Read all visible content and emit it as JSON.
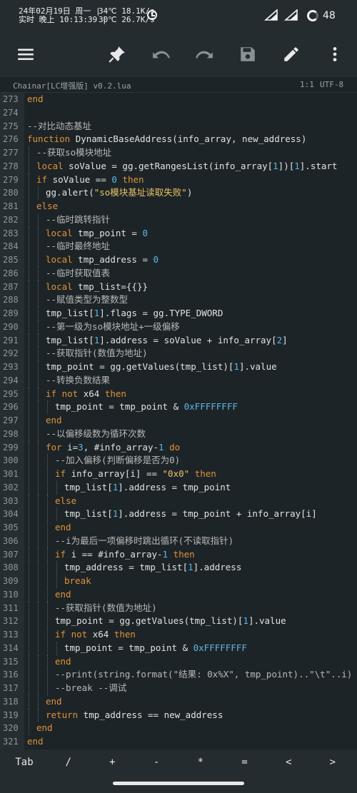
{
  "status": {
    "date_line": "24年02月19日 周一 |",
    "time_line": "实时 晚上 10:13:39 |",
    "temp_line1": "34℃  18.1K/s",
    "temp_line2": "30℃  26.7K/s",
    "battery": "48"
  },
  "toolbar": {
    "items": [
      "menu-icon",
      "pin-icon",
      "undo-icon",
      "redo-icon",
      "save-icon",
      "edit-icon",
      "more-icon"
    ]
  },
  "file": {
    "name": "Chainar[LC增强版] v0.2.lua",
    "position": "1:1",
    "encoding": "UTF-8"
  },
  "lines": [
    {
      "n": "273",
      "indent": 0,
      "tokens": [
        [
          "k",
          "end"
        ]
      ]
    },
    {
      "n": "274",
      "indent": 0,
      "tokens": []
    },
    {
      "n": "275",
      "indent": 0,
      "tokens": [
        [
          "c",
          "--对比动态基址"
        ]
      ]
    },
    {
      "n": "276",
      "indent": 0,
      "tokens": [
        [
          "k",
          "function"
        ],
        [
          "f",
          " DynamicBaseAddress(info_array, new_address)"
        ]
      ]
    },
    {
      "n": "277",
      "indent": 1,
      "tokens": [
        [
          "c",
          "--获取so模块地址"
        ]
      ]
    },
    {
      "n": "278",
      "indent": 1,
      "tokens": [
        [
          "k",
          "local"
        ],
        [
          "f",
          " soValue = gg.getRangesList(info_array["
        ],
        [
          "n",
          "1"
        ],
        [
          "f",
          "])["
        ],
        [
          "n",
          "1"
        ],
        [
          "f",
          "].start"
        ]
      ]
    },
    {
      "n": "279",
      "indent": 1,
      "tokens": [
        [
          "k",
          "if"
        ],
        [
          "f",
          " soValue == "
        ],
        [
          "n",
          "0"
        ],
        [
          "f",
          " "
        ],
        [
          "k",
          "then"
        ]
      ]
    },
    {
      "n": "280",
      "indent": 2,
      "tokens": [
        [
          "f",
          "gg.alert("
        ],
        [
          "s",
          "\"so模块基址读取失败\""
        ],
        [
          "f",
          ")"
        ]
      ]
    },
    {
      "n": "281",
      "indent": 1,
      "tokens": [
        [
          "k",
          "else"
        ]
      ]
    },
    {
      "n": "282",
      "indent": 2,
      "tokens": [
        [
          "c",
          "--临时跳转指针"
        ]
      ]
    },
    {
      "n": "283",
      "indent": 2,
      "tokens": [
        [
          "k",
          "local"
        ],
        [
          "f",
          " tmp_point = "
        ],
        [
          "n",
          "0"
        ]
      ]
    },
    {
      "n": "284",
      "indent": 2,
      "tokens": [
        [
          "c",
          "--临时最终地址"
        ]
      ]
    },
    {
      "n": "285",
      "indent": 2,
      "tokens": [
        [
          "k",
          "local"
        ],
        [
          "f",
          " tmp_address = "
        ],
        [
          "n",
          "0"
        ]
      ]
    },
    {
      "n": "286",
      "indent": 2,
      "tokens": [
        [
          "c",
          "--临时获取值表"
        ]
      ]
    },
    {
      "n": "287",
      "indent": 2,
      "tokens": [
        [
          "k",
          "local"
        ],
        [
          "f",
          " tmp_list={{}}"
        ]
      ]
    },
    {
      "n": "288",
      "indent": 2,
      "tokens": [
        [
          "c",
          "--赋值类型为整数型"
        ]
      ]
    },
    {
      "n": "289",
      "indent": 2,
      "tokens": [
        [
          "f",
          "tmp_list["
        ],
        [
          "n",
          "1"
        ],
        [
          "f",
          "].flags = gg.TYPE_DWORD"
        ]
      ]
    },
    {
      "n": "290",
      "indent": 2,
      "tokens": [
        [
          "c",
          "--第一级为so模块地址+一级偏移"
        ]
      ]
    },
    {
      "n": "291",
      "indent": 2,
      "tokens": [
        [
          "f",
          "tmp_list["
        ],
        [
          "n",
          "1"
        ],
        [
          "f",
          "].address = soValue + info_array["
        ],
        [
          "n",
          "2"
        ],
        [
          "f",
          "]"
        ]
      ]
    },
    {
      "n": "292",
      "indent": 2,
      "tokens": [
        [
          "c",
          "--获取指针(数值为地址)"
        ]
      ]
    },
    {
      "n": "293",
      "indent": 2,
      "tokens": [
        [
          "f",
          "tmp_point = gg.getValues(tmp_list)["
        ],
        [
          "n",
          "1"
        ],
        [
          "f",
          "].value"
        ]
      ]
    },
    {
      "n": "294",
      "indent": 2,
      "tokens": [
        [
          "c",
          "--转换负数结果"
        ]
      ]
    },
    {
      "n": "295",
      "indent": 2,
      "tokens": [
        [
          "k",
          "if"
        ],
        [
          "f",
          " "
        ],
        [
          "k",
          "not"
        ],
        [
          "f",
          " x64 "
        ],
        [
          "k",
          "then"
        ]
      ]
    },
    {
      "n": "296",
      "indent": 3,
      "tokens": [
        [
          "f",
          "tmp_point = tmp_point & "
        ],
        [
          "n",
          "0xFFFFFFFF"
        ]
      ]
    },
    {
      "n": "297",
      "indent": 2,
      "tokens": [
        [
          "k",
          "end"
        ]
      ]
    },
    {
      "n": "298",
      "indent": 2,
      "tokens": [
        [
          "c",
          "--以偏移级数为循环次数"
        ]
      ]
    },
    {
      "n": "299",
      "indent": 2,
      "tokens": [
        [
          "k",
          "for"
        ],
        [
          "f",
          " i="
        ],
        [
          "n",
          "3"
        ],
        [
          "f",
          ", #info_array-"
        ],
        [
          "n",
          "1"
        ],
        [
          "f",
          " "
        ],
        [
          "k",
          "do"
        ]
      ]
    },
    {
      "n": "300",
      "indent": 3,
      "tokens": [
        [
          "c",
          "--加入偏移(判断偏移是否为0)"
        ]
      ]
    },
    {
      "n": "301",
      "indent": 3,
      "tokens": [
        [
          "k",
          "if"
        ],
        [
          "f",
          " info_array[i] == "
        ],
        [
          "s",
          "\"0x0\""
        ],
        [
          "f",
          " "
        ],
        [
          "k",
          "then"
        ]
      ]
    },
    {
      "n": "302",
      "indent": 4,
      "tokens": [
        [
          "f",
          "tmp_list["
        ],
        [
          "n",
          "1"
        ],
        [
          "f",
          "].address = tmp_point"
        ]
      ]
    },
    {
      "n": "303",
      "indent": 3,
      "tokens": [
        [
          "k",
          "else"
        ]
      ]
    },
    {
      "n": "304",
      "indent": 4,
      "tokens": [
        [
          "f",
          "tmp_list["
        ],
        [
          "n",
          "1"
        ],
        [
          "f",
          "].address = tmp_point + info_array[i]"
        ]
      ]
    },
    {
      "n": "305",
      "indent": 3,
      "tokens": [
        [
          "k",
          "end"
        ]
      ]
    },
    {
      "n": "306",
      "indent": 3,
      "tokens": [
        [
          "c",
          "--i为最后一项偏移时跳出循环(不读取指针)"
        ]
      ]
    },
    {
      "n": "307",
      "indent": 3,
      "tokens": [
        [
          "k",
          "if"
        ],
        [
          "f",
          " i == #info_array-"
        ],
        [
          "n",
          "1"
        ],
        [
          "f",
          " "
        ],
        [
          "k",
          "then"
        ]
      ]
    },
    {
      "n": "308",
      "indent": 4,
      "tokens": [
        [
          "f",
          "tmp_address = tmp_list["
        ],
        [
          "n",
          "1"
        ],
        [
          "f",
          "].address"
        ]
      ]
    },
    {
      "n": "309",
      "indent": 4,
      "tokens": [
        [
          "k",
          "break"
        ]
      ]
    },
    {
      "n": "310",
      "indent": 3,
      "tokens": [
        [
          "k",
          "end"
        ]
      ]
    },
    {
      "n": "311",
      "indent": 3,
      "tokens": [
        [
          "c",
          "--获取指针(数值为地址)"
        ]
      ]
    },
    {
      "n": "312",
      "indent": 3,
      "tokens": [
        [
          "f",
          "tmp_point = gg.getValues(tmp_list)["
        ],
        [
          "n",
          "1"
        ],
        [
          "f",
          "].value"
        ]
      ]
    },
    {
      "n": "313",
      "indent": 3,
      "tokens": [
        [
          "k",
          "if"
        ],
        [
          "f",
          " "
        ],
        [
          "k",
          "not"
        ],
        [
          "f",
          " x64 "
        ],
        [
          "k",
          "then"
        ]
      ]
    },
    {
      "n": "314",
      "indent": 4,
      "tokens": [
        [
          "f",
          "tmp_point = tmp_point & "
        ],
        [
          "n",
          "0xFFFFFFFF"
        ]
      ]
    },
    {
      "n": "315",
      "indent": 3,
      "tokens": [
        [
          "k",
          "end"
        ]
      ]
    },
    {
      "n": "316",
      "indent": 3,
      "tokens": [
        [
          "c",
          "--print(string.format(\"结果: 0x%X\", tmp_point)..\"\\t\"..i)"
        ]
      ]
    },
    {
      "n": "317",
      "indent": 3,
      "tokens": [
        [
          "c",
          "--break --调试"
        ]
      ]
    },
    {
      "n": "318",
      "indent": 2,
      "tokens": [
        [
          "k",
          "end"
        ]
      ]
    },
    {
      "n": "319",
      "indent": 2,
      "tokens": [
        [
          "k",
          "return"
        ],
        [
          "f",
          " tmp_address == new_address"
        ]
      ]
    },
    {
      "n": "320",
      "indent": 1,
      "tokens": [
        [
          "k",
          "end"
        ]
      ]
    },
    {
      "n": "321",
      "indent": 0,
      "tokens": [
        [
          "k",
          "end"
        ]
      ]
    }
  ],
  "keys": [
    "Tab",
    "/",
    "+",
    "-",
    "*",
    "=",
    "<",
    ">"
  ]
}
